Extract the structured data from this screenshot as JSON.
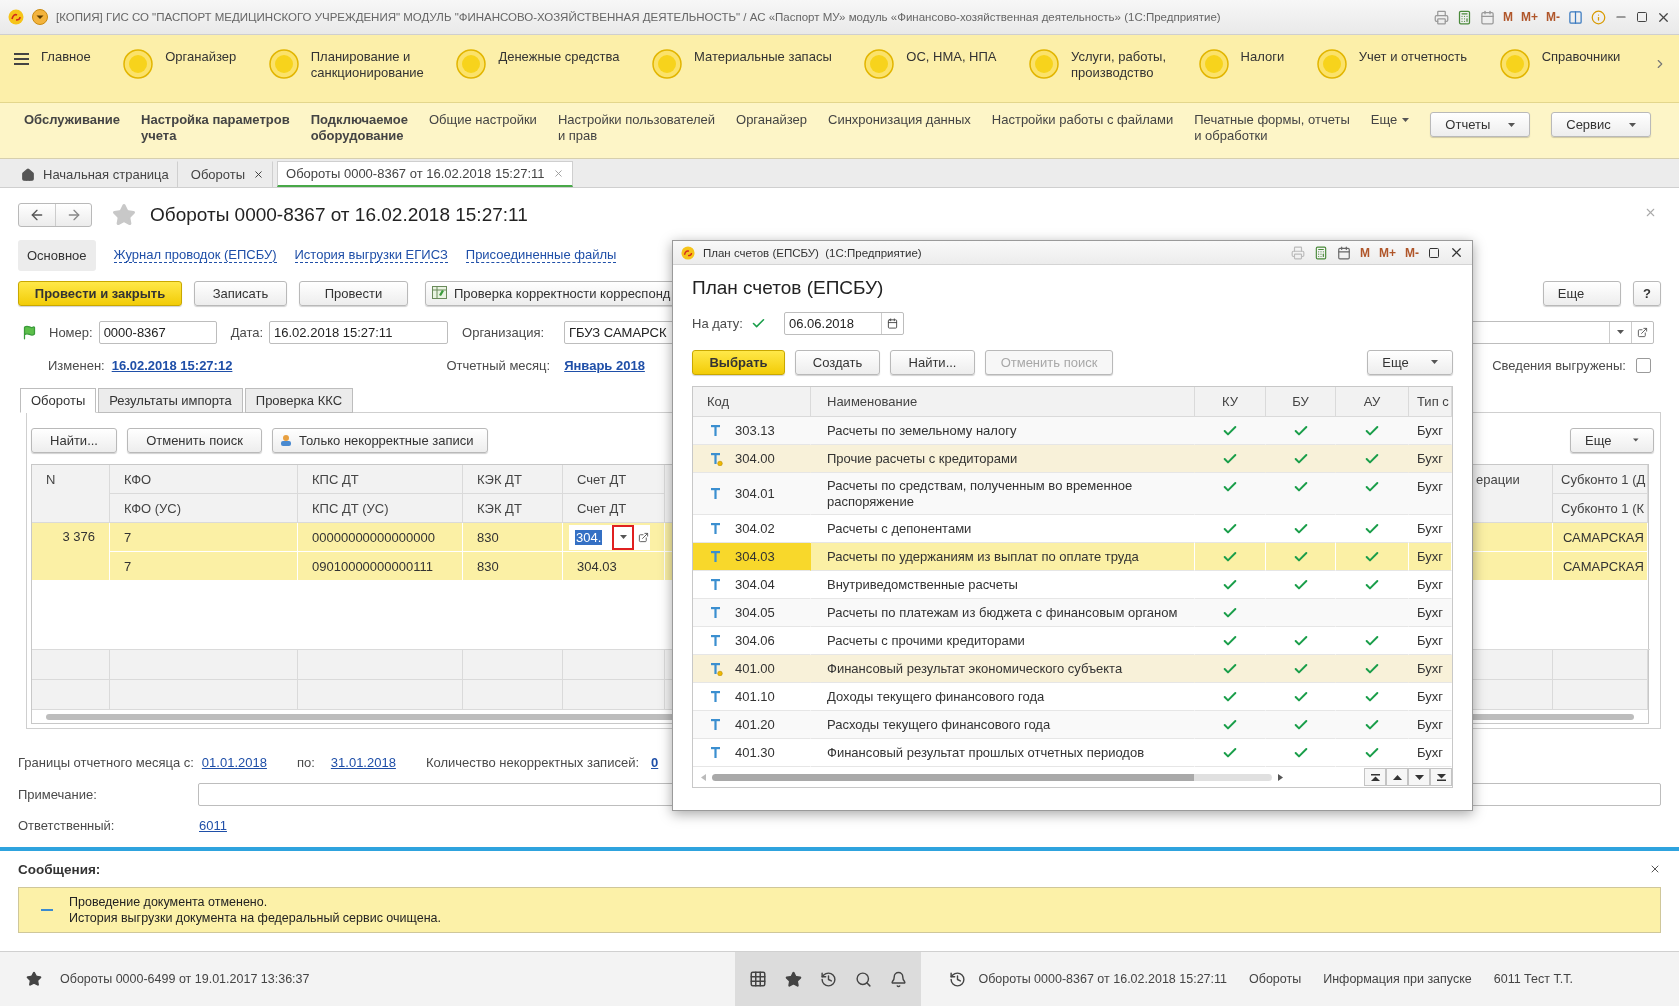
{
  "window": {
    "title": "[КОПИЯ] ГИС СО \"ПАСПОРТ МЕДИЦИНСКОГО УЧРЕЖДЕНИЯ\" МОДУЛЬ \"ФИНАНСОВО-ХОЗЯЙСТВЕННАЯ ДЕЯТЕЛЬНОСТЬ\" / АС «Паспорт МУ» модуль «Финансово-хозяйственная деятельность» (1С:Предприятие)",
    "memory_keys": [
      "M",
      "M+",
      "M-"
    ]
  },
  "sections": [
    {
      "label": "Главное",
      "kind": "menu"
    },
    {
      "label": "Органайзер",
      "kind": "section"
    },
    {
      "label": "Планирование и\nсанкционирование",
      "kind": "section"
    },
    {
      "label": "Денежные средства",
      "kind": "section"
    },
    {
      "label": "Материальные запасы",
      "kind": "section"
    },
    {
      "label": "ОС, НМА, НПА",
      "kind": "section"
    },
    {
      "label": "Услуги, работы,\nпроизводство",
      "kind": "section"
    },
    {
      "label": "Налоги",
      "kind": "section"
    },
    {
      "label": "Учет и отчетность",
      "kind": "section"
    },
    {
      "label": "Справочники",
      "kind": "section"
    }
  ],
  "commands": [
    {
      "label": "Обслуживание",
      "kind": "bold"
    },
    {
      "label": "Настройка параметров\nучета",
      "kind": "bold"
    },
    {
      "label": "Подключаемое\nоборудование",
      "kind": "bold"
    },
    {
      "label": "Общие настройки",
      "kind": "plain"
    },
    {
      "label": "Настройки пользователей\nи прав",
      "kind": "plain"
    },
    {
      "label": "Органайзер",
      "kind": "plain"
    },
    {
      "label": "Синхронизация данных",
      "kind": "plain"
    },
    {
      "label": "Настройки работы с файлами",
      "kind": "plain"
    },
    {
      "label": "Печатные формы, отчеты\nи обработки",
      "kind": "plain"
    },
    {
      "label": "Еще",
      "kind": "dropdown"
    },
    {
      "label": "Отчеты",
      "kind": "button"
    },
    {
      "label": "Сервис",
      "kind": "button"
    }
  ],
  "open_tabs": [
    {
      "label": "Начальная страница",
      "kind": "home",
      "selected": false
    },
    {
      "label": "Обороты",
      "kind": "closable",
      "selected": false
    },
    {
      "label": "Обороты 0000-8367 от 16.02.2018 15:27:11",
      "kind": "closable",
      "selected": true
    }
  ],
  "document": {
    "title": "Обороты 0000-8367 от 16.02.2018 15:27:11",
    "favorite": false,
    "links": [
      {
        "label": "Основное",
        "selected": true
      },
      {
        "label": "Журнал проводок (ЕПСБУ)",
        "selected": false
      },
      {
        "label": "История выгрузки ЕГИСЗ",
        "selected": false
      },
      {
        "label": "Присоединенные файлы",
        "selected": false
      }
    ],
    "buttons": [
      {
        "label": "Провести и закрыть",
        "kind": "primary"
      },
      {
        "label": "Записать",
        "kind": "plain"
      },
      {
        "label": "Провести",
        "kind": "plain"
      },
      {
        "label": "Проверка корректности корреспонд",
        "kind": "icon"
      }
    ],
    "more_button": "Еще",
    "help_button": "?",
    "number": {
      "label": "Номер:",
      "value": "0000-8367"
    },
    "date": {
      "label": "Дата:",
      "value": "16.02.2018 15:27:11"
    },
    "organization": {
      "label": "Организация:",
      "value": "ГБУЗ САМАРСК"
    },
    "changed": {
      "label": "Изменен:",
      "value": "16.02.2018 15:27:12"
    },
    "month": {
      "label": "Отчетный месяц:",
      "value": "Январь 2018"
    },
    "uploaded": {
      "label": "Сведения выгружены:",
      "checked": false
    },
    "tabs": [
      {
        "label": "Обороты",
        "selected": true
      },
      {
        "label": "Результаты импорта",
        "selected": false
      },
      {
        "label": "Проверка ККС",
        "selected": false
      }
    ],
    "table_buttons": [
      {
        "label": "Найти...",
        "kind": "plain"
      },
      {
        "label": "Отменить поиск",
        "kind": "plain"
      },
      {
        "label": "Только некорректные записи",
        "kind": "icon"
      }
    ],
    "table_more": "Еще",
    "table": {
      "columns": [
        {
          "top": "N"
        },
        {
          "top": "КФО",
          "bottom": "КФО (УС)"
        },
        {
          "top": "КПС ДТ",
          "bottom": "КПС ДТ (УС)"
        },
        {
          "top": "КЭК ДТ",
          "bottom": "КЭК ДТ"
        },
        {
          "top": "Счет ДТ",
          "bottom": "Счет ДТ"
        },
        {
          "top": "ерации"
        },
        {
          "top": "Субконто 1 (Д",
          "bottom": "Субконто 1 (К"
        }
      ],
      "rows": [
        {
          "selected": true,
          "n": "3 376",
          "lines": [
            {
              "kfo": "7",
              "kps": "00000000000000000",
              "kek": "830",
              "account": "304.",
              "editing": true,
              "subkonto": "САМАРСКАЯ"
            },
            {
              "kfo": "7",
              "kps": "09010000000000111",
              "kek": "830",
              "account": "304.03",
              "editing": false,
              "subkonto": "САМАРСКАЯ"
            }
          ]
        }
      ]
    },
    "period": {
      "label": "Границы отчетного месяца с:",
      "from": "01.01.2018",
      "to_label": "по:",
      "to": "31.01.2018",
      "errors_label": "Количество некорректных записей:",
      "errors": "0"
    },
    "note": {
      "label": "Примечание:"
    },
    "responsible": {
      "label": "Ответственный:",
      "value": "6011"
    }
  },
  "messages": {
    "title": "Сообщения:",
    "lines": [
      "Проведение документа отменено.",
      "История выгрузки документа на федеральный сервис очищена."
    ]
  },
  "status_bar": {
    "history": "Обороты 0000-6499 от 19.01.2017 13:36:37",
    "current": "Обороты 0000-8367 от 16.02.2018 15:27:11",
    "items": [
      "Обороты",
      "Информация при запуске",
      "6011 Тест Т.Т."
    ]
  },
  "modal": {
    "title": "План счетов (ЕПСБУ)  (1С:Предприятие)",
    "memory_keys": [
      "M",
      "M+",
      "M-"
    ],
    "heading": "План счетов (ЕПСБУ)",
    "date": {
      "label": "На дату:",
      "checked": true,
      "value": "06.06.2018"
    },
    "buttons": [
      {
        "label": "Выбрать",
        "kind": "primary"
      },
      {
        "label": "Создать",
        "kind": "plain"
      },
      {
        "label": "Найти...",
        "kind": "plain"
      },
      {
        "label": "Отменить поиск",
        "kind": "disabled"
      }
    ],
    "more": "Еще",
    "columns": [
      "Код",
      "Наименование",
      "КУ",
      "БУ",
      "АУ",
      "Тип с"
    ],
    "rows": [
      {
        "code": "303.13",
        "name": "Расчеты по земельному налогу",
        "kind": "account",
        "ku": true,
        "bu": true,
        "au": true,
        "type": "Бухг",
        "selected": false
      },
      {
        "code": "304.00",
        "name": "Прочие расчеты с кредиторами",
        "kind": "group",
        "ku": true,
        "bu": true,
        "au": true,
        "type": "Бухг",
        "selected": false
      },
      {
        "code": "304.01",
        "name": "Расчеты по средствам, полученным во временное распоряжение",
        "kind": "account",
        "ku": true,
        "bu": true,
        "au": true,
        "type": "Бухг",
        "selected": false
      },
      {
        "code": "304.02",
        "name": "Расчеты с депонентами",
        "kind": "account",
        "ku": true,
        "bu": true,
        "au": true,
        "type": "Бухг",
        "selected": false
      },
      {
        "code": "304.03",
        "name": "Расчеты по удержаниям из выплат по оплате труда",
        "kind": "account",
        "ku": true,
        "bu": true,
        "au": true,
        "type": "Бухг",
        "selected": true
      },
      {
        "code": "304.04",
        "name": "Внутриведомственные расчеты",
        "kind": "account",
        "ku": true,
        "bu": true,
        "au": true,
        "type": "Бухг",
        "selected": false
      },
      {
        "code": "304.05",
        "name": "Расчеты по платежам из бюджета с финансовым органом",
        "kind": "account",
        "ku": true,
        "bu": false,
        "au": false,
        "type": "Бухг",
        "selected": false
      },
      {
        "code": "304.06",
        "name": "Расчеты с прочими кредиторами",
        "kind": "account",
        "ku": true,
        "bu": true,
        "au": true,
        "type": "Бухг",
        "selected": false
      },
      {
        "code": "401.00",
        "name": "Финансовый результат экономического субъекта",
        "kind": "group",
        "ku": true,
        "bu": true,
        "au": true,
        "type": "Бухг",
        "selected": false
      },
      {
        "code": "401.10",
        "name": "Доходы текущего финансового года",
        "kind": "account",
        "ku": true,
        "bu": true,
        "au": true,
        "type": "Бухг",
        "selected": false
      },
      {
        "code": "401.20",
        "name": "Расходы текущего финансового года",
        "kind": "account",
        "ku": true,
        "bu": true,
        "au": true,
        "type": "Бухг",
        "selected": false
      },
      {
        "code": "401.30",
        "name": "Финансовый результат прошлых отчетных периодов",
        "kind": "account",
        "ku": true,
        "bu": true,
        "au": true,
        "type": "Бухг",
        "selected": false
      }
    ]
  }
}
